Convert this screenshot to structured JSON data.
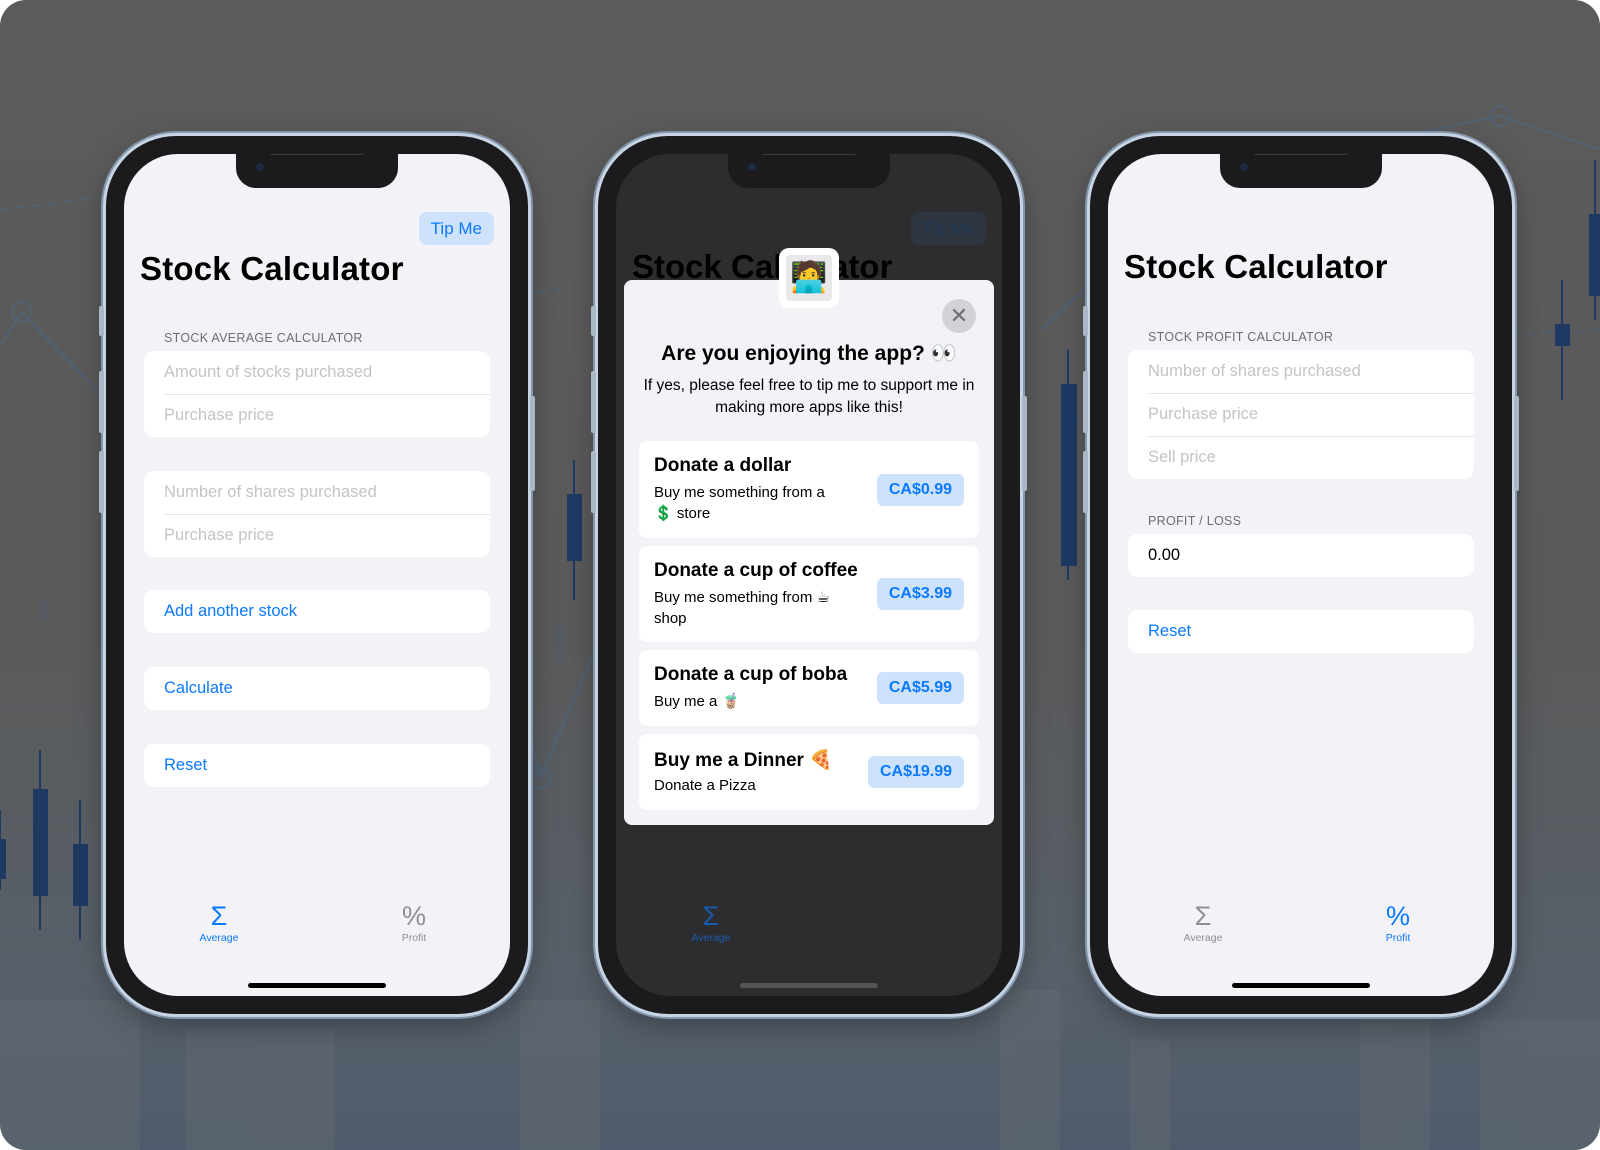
{
  "phone_left": {
    "tip_button": "Tip Me",
    "title": "Stock Calculator",
    "section_label": "STOCK AVERAGE CALCULATOR",
    "group1": [
      "Amount of stocks purchased",
      "Purchase price"
    ],
    "group2": [
      "Number of shares purchased",
      "Purchase price"
    ],
    "add_stock": "Add another stock",
    "calculate": "Calculate",
    "reset": "Reset",
    "tabs": [
      {
        "icon": "Σ",
        "label": "Average",
        "active": true
      },
      {
        "icon": "%",
        "label": "Profit",
        "active": false
      }
    ]
  },
  "phone_middle": {
    "tip_button": "Tip Me",
    "title": "Stock Calculator",
    "avatar_icon": "🧑‍💻",
    "close_icon": "✕",
    "heading": "Are you enjoying the app? 👀",
    "subtitle": "If yes, please feel free to tip me to support me in making more apps like this!",
    "items": [
      {
        "title": "Donate a dollar",
        "desc": "Buy me something from a 💲 store",
        "price": "CA$0.99"
      },
      {
        "title": "Donate a cup of coffee",
        "desc": "Buy me something from ☕ shop",
        "price": "CA$3.99"
      },
      {
        "title": "Donate a cup of boba",
        "desc": "Buy me a 🧋",
        "price": "CA$5.99"
      },
      {
        "title": "Buy me a Dinner 🍕",
        "desc": "Donate a Pizza",
        "price": "CA$19.99"
      }
    ],
    "tabs": [
      {
        "icon": "Σ",
        "label": "Average",
        "active": true
      }
    ]
  },
  "phone_right": {
    "title": "Stock Calculator",
    "section_label": "STOCK PROFIT CALCULATOR",
    "group1": [
      "Number of shares purchased",
      "Purchase price",
      "Sell price"
    ],
    "result_label": "PROFIT / LOSS",
    "result_value": "0.00",
    "reset": "Reset",
    "tabs": [
      {
        "icon": "Σ",
        "label": "Average",
        "active": false
      },
      {
        "icon": "%",
        "label": "Profit",
        "active": true
      }
    ]
  },
  "colors": {
    "accent": "#0a7aff",
    "accent_bg": "#cfe2fb",
    "screen_bg": "#f2f2f7",
    "backdrop": "#5b5b5b"
  }
}
